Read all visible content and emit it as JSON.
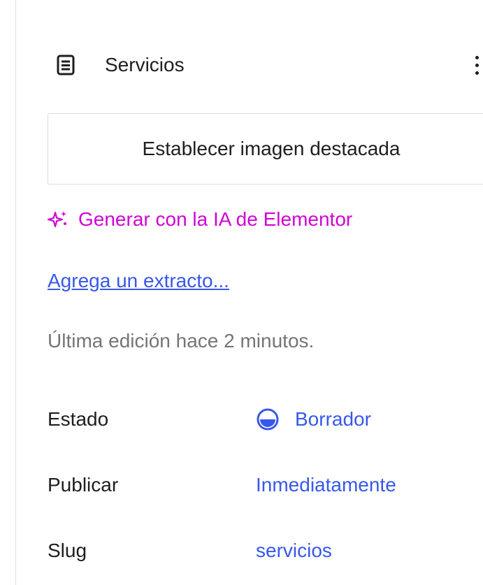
{
  "document": {
    "title": "Servicios",
    "icon": "document-icon",
    "more_icon": "more-vertical-icon"
  },
  "featured_image": {
    "label": "Establecer imagen destacada"
  },
  "ai": {
    "label": "Generar con la IA de Elementor",
    "icon": "sparkle-icon",
    "color": "#d004d4"
  },
  "excerpt": {
    "label": "Agrega un extracto..."
  },
  "last_edited": "Última edición hace 2 minutos.",
  "meta": {
    "status": {
      "label": "Estado",
      "value": "Borrador",
      "icon": "draft-status-icon"
    },
    "publish": {
      "label": "Publicar",
      "value": "Inmediatamente"
    },
    "slug": {
      "label": "Slug",
      "value": "servicios"
    }
  },
  "colors": {
    "link": "#3858e9",
    "muted": "#757575",
    "text": "#1e1e1e"
  }
}
